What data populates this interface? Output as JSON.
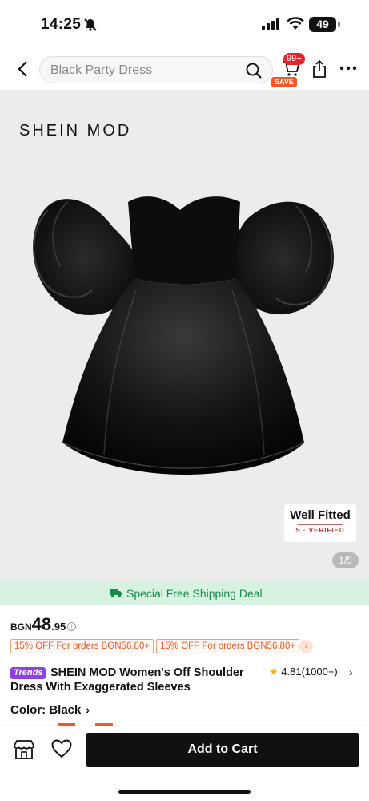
{
  "status_bar": {
    "time": "14:25",
    "battery": "49"
  },
  "nav": {
    "search_placeholder": "Black Party Dress",
    "cart_badge": "99+",
    "save_badge": "SAVE"
  },
  "hero": {
    "brand": "SHEIN MOD",
    "fit_title": "Well Fitted",
    "fit_sub": "S · VERIFIED",
    "pager": "1/5"
  },
  "shipping": {
    "text": "Special Free Shipping Deal",
    "color": "#1a8a4a"
  },
  "price": {
    "currency": "BGN",
    "whole": "48",
    "cents": ".95",
    "info": "i"
  },
  "coupons": [
    {
      "label": "15% OFF For orders BGN56.80+"
    },
    {
      "label": "15% OFF For orders BGN56.80+"
    }
  ],
  "product": {
    "trends_badge": "Trends",
    "title": "SHEIN MOD Women's Off Shoulder Dress With Exaggerated Sleeves",
    "rating": "4.81",
    "rating_count": "(1000+)"
  },
  "color": {
    "label": "Color: Black"
  },
  "bottom_bar": {
    "add_to_cart": "Add to Cart"
  },
  "colors": {
    "accent": "#f05a26",
    "badge_red": "#e4252b",
    "trends_purple": "#8f3fe6",
    "shipping_bg": "#d7f2e1"
  },
  "icons": [
    "back-icon",
    "search-icon",
    "cart-icon",
    "share-icon",
    "more-icon",
    "truck-icon",
    "star-icon",
    "store-icon",
    "heart-icon"
  ]
}
